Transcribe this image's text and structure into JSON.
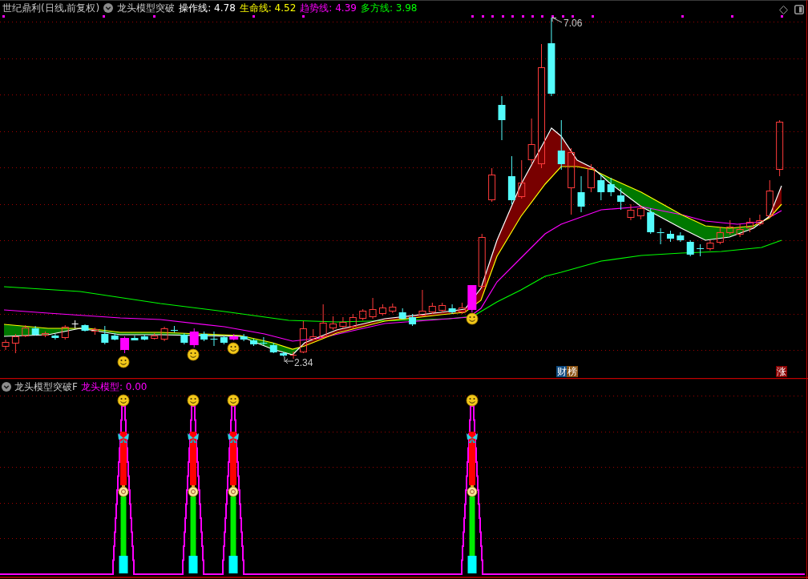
{
  "main_panel": {
    "title": "世纪鼎利(日线,前复权)",
    "indicator": "龙头模型突破",
    "readings": [
      {
        "text": "操作线: 4.78",
        "color": "#ffffff"
      },
      {
        "text": "生命线: 4.52",
        "color": "#ffff00"
      },
      {
        "text": "趋势线: 4.39",
        "color": "#ff00ff"
      },
      {
        "text": "多方线: 3.98",
        "color": "#00ff00"
      }
    ],
    "high_label": "7.06",
    "low_label": "2.34",
    "badges": [
      {
        "text": "财",
        "color": "#0e4a80"
      },
      {
        "text": "榜",
        "color": "#8c5414"
      },
      {
        "text": "涨",
        "color": "#8b0000"
      }
    ]
  },
  "sub_panel": {
    "indicator": "龙头模型突破F",
    "readings": [
      {
        "text": "龙头模型: 0.00",
        "color": "#ff00ff"
      }
    ]
  }
}
